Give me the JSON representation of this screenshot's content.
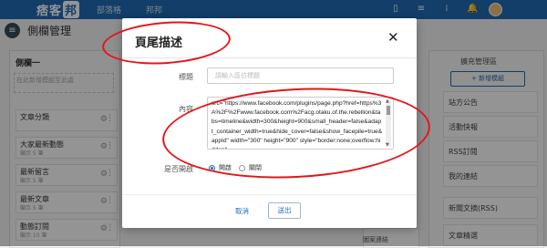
{
  "topbar": {
    "logo": "痞客",
    "logo_box": "邦",
    "nav": [
      "部落格",
      "邦邦"
    ]
  },
  "page": {
    "title": "側欄管理",
    "col1_header": "側欄一",
    "hint": "在此新增模組至此處",
    "widgets": [
      {
        "title": "文章分類",
        "sub": ""
      },
      {
        "title": "大家最新動態",
        "sub": "顯示 5 筆"
      },
      {
        "title": "最新留言",
        "sub": "顯示 5 筆"
      },
      {
        "title": "最新文章",
        "sub": "顯示 5 筆"
      },
      {
        "title": "動態訂閱",
        "sub": "顯示 10 筆"
      }
    ],
    "col3_header": "擴充管理區",
    "add_button": "+ 新增模組",
    "right_items": [
      "站方公告",
      "活動快報",
      "RSS訂閱",
      "我的連結",
      "新聞文摘(RSS)",
      "文章精選"
    ],
    "peek_label": "圖案連結"
  },
  "modal": {
    "title": "頁尾描述",
    "title_label": "標題",
    "title_placeholder": "請輸入區位標題",
    "content_label": "內容",
    "content_text": "src=\"https://www.facebook.com/plugins/page.php?href=https%3A%2F%2Fwww.facebook.com%2Facg.otaku.of.the.rebellion&tabs=timeline&width=300&height=900&small_header=false&adapt_container_width=true&hide_cover=false&show_facepile=true&appId\" width=\"300\" height=\"900\" style=\"border:none;overflow:hidden\"",
    "enable_label": "是否開啟",
    "options": [
      "開啟",
      "關閉"
    ],
    "selected_option": "開啟",
    "cancel": "取消",
    "submit": "送出"
  },
  "annotation_color": "#e4161b",
  "accent_color": "#1f6bb5"
}
